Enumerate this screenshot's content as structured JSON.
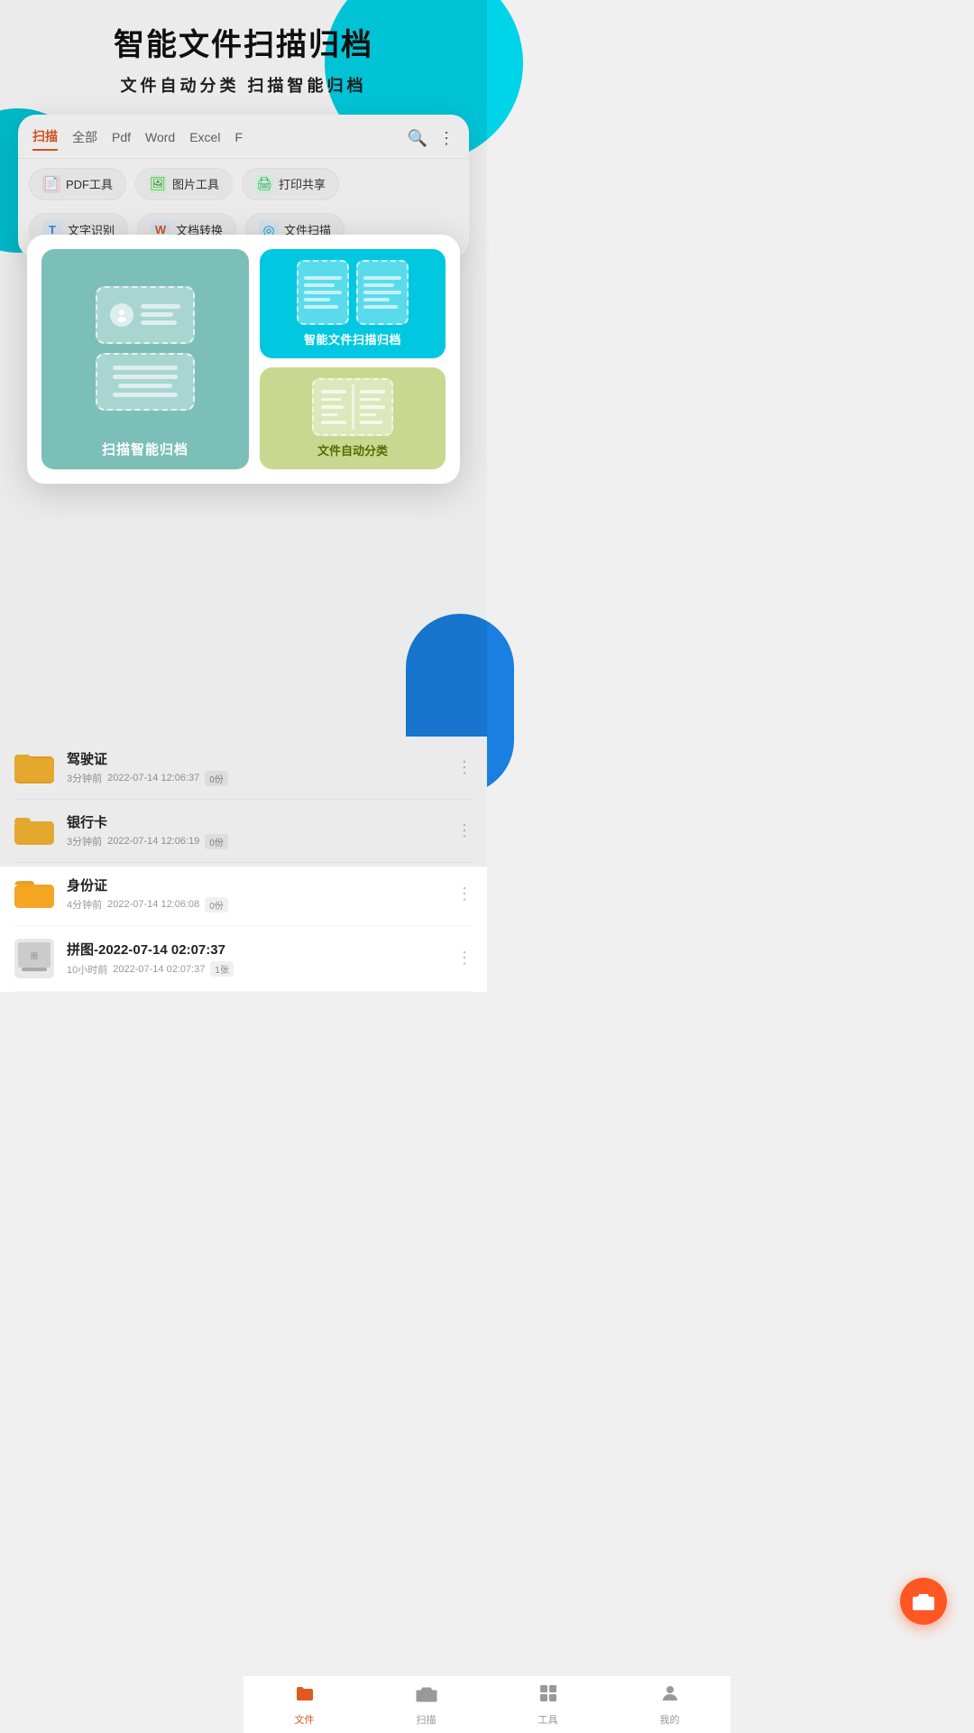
{
  "hero": {
    "title": "智能文件扫描归档",
    "subtitle": "文件自动分类   扫描智能归档"
  },
  "tabs": {
    "items": [
      {
        "label": "扫描",
        "active": true
      },
      {
        "label": "全部",
        "active": false
      },
      {
        "label": "Pdf",
        "active": false
      },
      {
        "label": "Word",
        "active": false
      },
      {
        "label": "Excel",
        "active": false
      },
      {
        "label": "F",
        "active": false
      }
    ]
  },
  "tools": [
    {
      "icon": "📄",
      "label": "PDF工具",
      "type": "pdf"
    },
    {
      "icon": "🖼",
      "label": "图片工具",
      "type": "img"
    },
    {
      "icon": "🖨",
      "label": "打印共享",
      "type": "print"
    }
  ],
  "features": [
    {
      "icon": "T",
      "label": "文字识别"
    },
    {
      "icon": "W",
      "label": "文档转换"
    },
    {
      "icon": "◎",
      "label": "文件扫描"
    }
  ],
  "popup": {
    "left_label": "扫描智能归档",
    "right_top_label": "智能文件扫描归档",
    "right_bottom_label": "文件自动分类"
  },
  "files": [
    {
      "name": "驾驶证",
      "meta": "3分钟前",
      "date": "2022-07-14 12:06:37",
      "count": "0份",
      "type": "folder"
    },
    {
      "name": "银行卡",
      "meta": "3分钟前",
      "date": "2022-07-14 12:06:19",
      "count": "0份",
      "type": "folder"
    },
    {
      "name": "身份证",
      "meta": "4分钟前",
      "date": "2022-07-14 12:06:08",
      "count": "0份",
      "type": "folder"
    },
    {
      "name": "拼图-2022-07-14 02:07:37",
      "meta": "10小时前",
      "date": "2022-07-14 02:07:37",
      "count": "1张",
      "type": "image"
    }
  ],
  "nav": {
    "items": [
      {
        "icon": "📁",
        "label": "文件",
        "active": true
      },
      {
        "icon": "📷",
        "label": "扫描",
        "active": false
      },
      {
        "icon": "⚙",
        "label": "工具",
        "active": false
      },
      {
        "icon": "👤",
        "label": "我的",
        "active": false
      }
    ]
  }
}
